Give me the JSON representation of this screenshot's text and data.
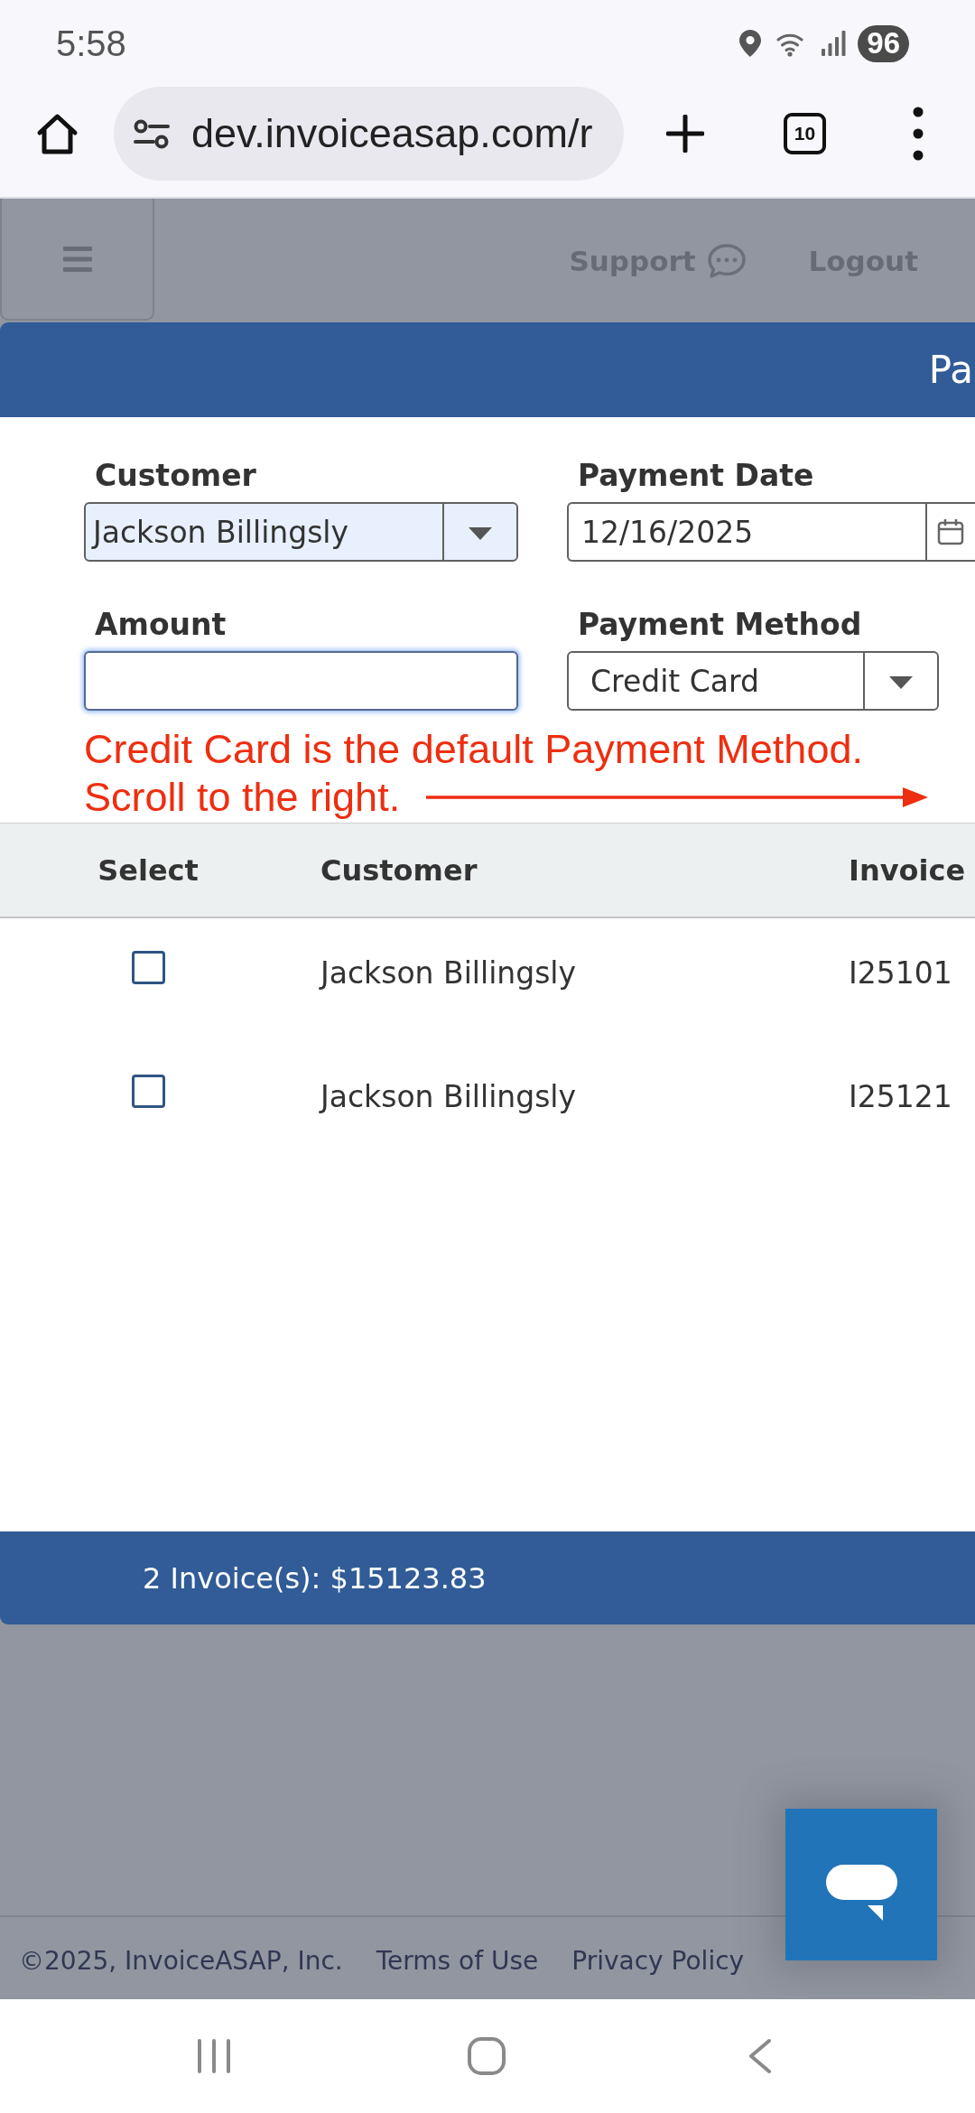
{
  "status_bar": {
    "time": "5:58",
    "battery": "96"
  },
  "browser": {
    "url": "dev.invoiceasap.com/r",
    "tab_count": "10"
  },
  "header": {
    "links": [
      {
        "label": "Support",
        "kind": "support"
      },
      {
        "label": "Logout",
        "kind": "plain"
      }
    ]
  },
  "dialog": {
    "title": "Pa",
    "fields": [
      {
        "label": "Customer",
        "kind": "select",
        "value": "Jackson Billingsly",
        "autofilled": true
      },
      {
        "label": "Payment Date",
        "kind": "date",
        "value": "12/16/2025"
      },
      {
        "label": "Amount",
        "kind": "text",
        "focused": true
      },
      {
        "label": "Payment Method",
        "kind": "select",
        "value": "Credit Card",
        "autofilled": false
      }
    ],
    "annotation": {
      "lines": [
        "Credit Card is the default Payment Method.",
        "Scroll to the right."
      ]
    },
    "table": {
      "columns": [
        "Select",
        "Customer",
        "Invoice"
      ],
      "rows": [
        {
          "checked": false,
          "customer": "Jackson Billingsly",
          "invoice": "I25101"
        },
        {
          "checked": false,
          "customer": "Jackson Billingsly",
          "invoice": "I25121"
        }
      ]
    },
    "summary": "2 Invoice(s): $15123.83"
  },
  "footer": {
    "copyright": "©2025, InvoiceASAP, Inc.",
    "links": [
      "Terms of Use",
      "Privacy Policy"
    ]
  }
}
